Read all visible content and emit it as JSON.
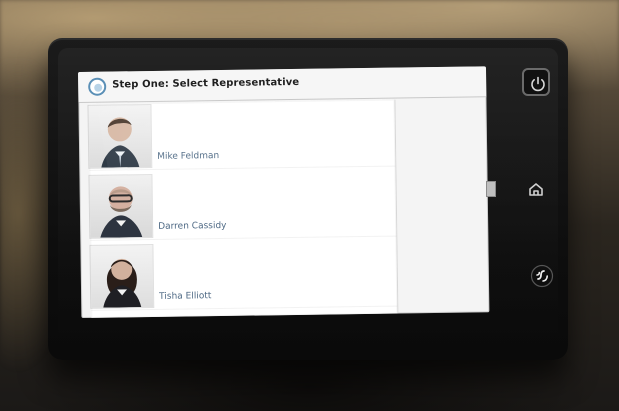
{
  "screen": {
    "title": "Step One: Select Representative",
    "list": {
      "items": [
        {
          "name": "Mike Feldman",
          "photo_icon": "portrait-photo"
        },
        {
          "name": "Darren Cassidy",
          "photo_icon": "portrait-photo"
        },
        {
          "name": "Tisha Elliott",
          "photo_icon": "portrait-photo"
        }
      ]
    }
  },
  "device": {
    "hardware_icons": [
      "power-icon",
      "home-icon",
      "nfc-icon"
    ]
  },
  "colors": {
    "name_text": "#4f6a85",
    "header_text": "#1f1f1f"
  }
}
